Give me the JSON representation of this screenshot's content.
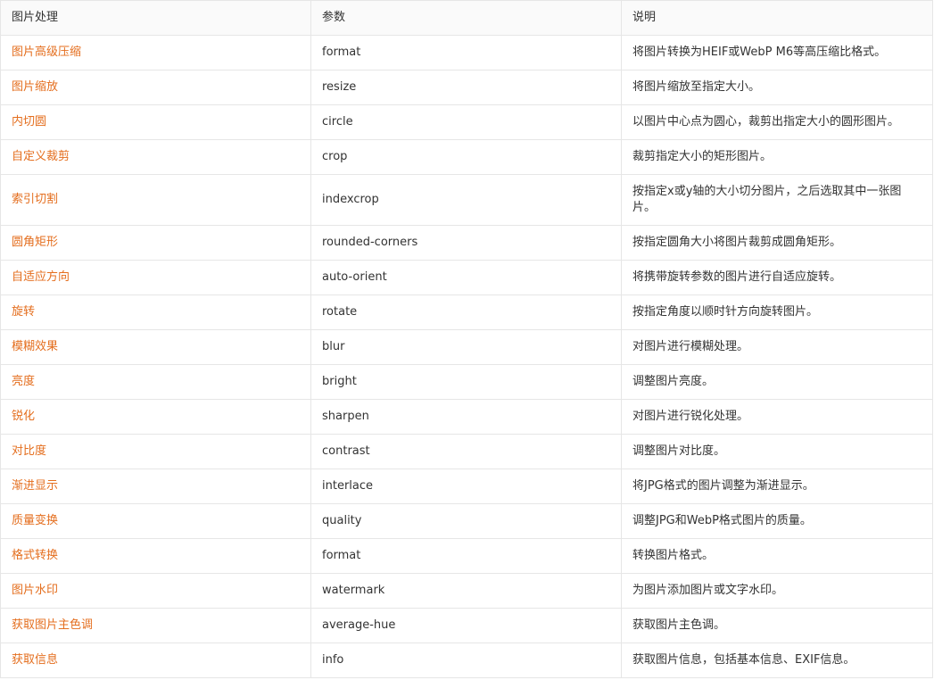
{
  "colors": {
    "link": "#e46e1e",
    "header_bg": "#fafafa",
    "border": "#e6e6e6",
    "text": "#333333"
  },
  "table": {
    "headers": [
      "图片处理",
      "参数",
      "说明"
    ],
    "rows": [
      {
        "name": "图片高级压缩",
        "param": "format",
        "desc": "将图片转换为HEIF或WebP M6等高压缩比格式。"
      },
      {
        "name": "图片缩放",
        "param": "resize",
        "desc": "将图片缩放至指定大小。"
      },
      {
        "name": "内切圆",
        "param": "circle",
        "desc": "以图片中心点为圆心，裁剪出指定大小的圆形图片。"
      },
      {
        "name": "自定义裁剪",
        "param": "crop",
        "desc": "裁剪指定大小的矩形图片。"
      },
      {
        "name": "索引切割",
        "param": "indexcrop",
        "desc": "按指定x或y轴的大小切分图片，之后选取其中一张图片。"
      },
      {
        "name": "圆角矩形",
        "param": "rounded-corners",
        "desc": "按指定圆角大小将图片裁剪成圆角矩形。"
      },
      {
        "name": "自适应方向",
        "param": "auto-orient",
        "desc": "将携带旋转参数的图片进行自适应旋转。"
      },
      {
        "name": "旋转",
        "param": "rotate",
        "desc": "按指定角度以顺时针方向旋转图片。"
      },
      {
        "name": "模糊效果",
        "param": "blur",
        "desc": "对图片进行模糊处理。"
      },
      {
        "name": "亮度",
        "param": "bright",
        "desc": "调整图片亮度。"
      },
      {
        "name": "锐化",
        "param": "sharpen",
        "desc": "对图片进行锐化处理。"
      },
      {
        "name": "对比度",
        "param": "contrast",
        "desc": "调整图片对比度。"
      },
      {
        "name": "渐进显示",
        "param": "interlace",
        "desc": "将JPG格式的图片调整为渐进显示。"
      },
      {
        "name": "质量变换",
        "param": "quality",
        "desc": "调整JPG和WebP格式图片的质量。"
      },
      {
        "name": "格式转换",
        "param": "format",
        "desc": "转换图片格式。"
      },
      {
        "name": "图片水印",
        "param": "watermark",
        "desc": "为图片添加图片或文字水印。"
      },
      {
        "name": "获取图片主色调",
        "param": "average-hue",
        "desc": "获取图片主色调。"
      },
      {
        "name": "获取信息",
        "param": "info",
        "desc": "获取图片信息，包括基本信息、EXIF信息。"
      }
    ]
  }
}
